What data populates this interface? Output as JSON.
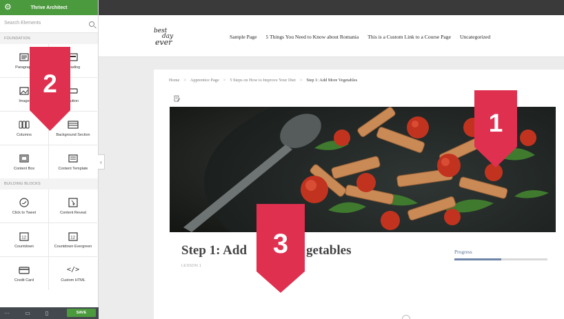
{
  "panel": {
    "title": "Thrive Architect",
    "search_placeholder": "Search Elements",
    "sections": [
      {
        "label": "FOUNDATION",
        "items": [
          {
            "label": "Paragraph",
            "icon": "paragraph-icon"
          },
          {
            "label": "Heading",
            "icon": "heading-icon"
          },
          {
            "label": "Image",
            "icon": "image-icon"
          },
          {
            "label": "Button",
            "icon": "button-icon"
          },
          {
            "label": "Columns",
            "icon": "columns-icon"
          },
          {
            "label": "Background Section",
            "icon": "background-section-icon"
          },
          {
            "label": "Content Box",
            "icon": "content-box-icon"
          },
          {
            "label": "Content Template",
            "icon": "content-template-icon"
          }
        ]
      },
      {
        "label": "BUILDING BLOCKS",
        "items": [
          {
            "label": "Click to Tweet",
            "icon": "twitter-icon"
          },
          {
            "label": "Content Reveal",
            "icon": "content-reveal-icon"
          },
          {
            "label": "Countdown",
            "icon": "countdown-icon"
          },
          {
            "label": "Countdown Evergreen",
            "icon": "countdown-evergreen-icon"
          },
          {
            "label": "Credit Card",
            "icon": "credit-card-icon"
          },
          {
            "label": "Custom HTML",
            "icon": "code-icon"
          }
        ]
      }
    ],
    "footer": {
      "more": "···",
      "save_label": "SAVE"
    }
  },
  "site": {
    "logo_text": "best day ever",
    "nav": [
      "Sample Page",
      "5 Things You Need to Know about Romania",
      "This is a Custom Link to a Course Page",
      "Uncategorized"
    ]
  },
  "breadcrumb": {
    "items": [
      "Home",
      "Apprentice Page",
      "5 Steps on How to Improve Your Diet"
    ],
    "current": "Step 1: Add More Vegetables",
    "separator": ">"
  },
  "lesson": {
    "title": "Step 1: Add More Vegetables",
    "visible_title_left": "Step 1: Add",
    "visible_title_right": "getables",
    "subtitle": "LESSON 1",
    "progress_label": "Progress",
    "progress": 0.5
  },
  "callouts": [
    "1",
    "2",
    "3"
  ],
  "colors": {
    "brand_green": "#4c9a3e",
    "ribbon_red": "#e0304f",
    "topbar": "#3a3a3a",
    "progress_blue": "#6d84a8"
  }
}
